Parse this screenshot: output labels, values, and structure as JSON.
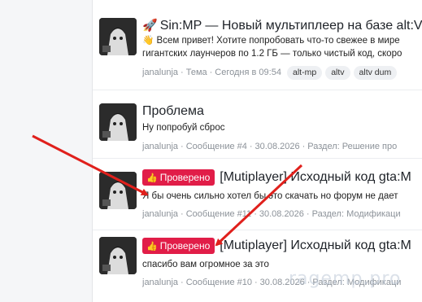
{
  "results": [
    {
      "title_icon": "🚀",
      "title": "Sin:MP — Новый мультиплеер на базе alt:V! д",
      "snippet_icon": "👋",
      "snippet_line1": "Всем привет! Хотите попробовать что-то свежее в мире",
      "snippet_line2": "гигантских лаунчеров по 1.2 ГБ — только чистый код, скоро",
      "author": "janalunja",
      "type": "Тема",
      "date": "Сегодня в 09:54",
      "tags": [
        "alt-mp",
        "altv",
        "altv dum"
      ]
    },
    {
      "title": "Проблема",
      "snippet": "Ну попробуй сброс",
      "author": "janalunja",
      "type": "Сообщение #4",
      "date": "30.08.2026",
      "section": "Раздел: Решение про"
    },
    {
      "badge": "Проверено",
      "title": "[Mutiplayer] Исходный код gta:M",
      "snippet": "Я бы очень сильно хотел бы это скачать но форум не дает",
      "author": "janalunja",
      "type": "Сообщение #11",
      "date": "30.08.2026",
      "section": "Раздел: Модификаци"
    },
    {
      "badge": "Проверено",
      "title": "[Mutiplayer] Исходный код gta:M",
      "snippet": "спасибо вам огромное за это",
      "author": "janalunja",
      "type": "Сообщение #10",
      "date": "30.08.2026",
      "section": "Раздел: Модификаци"
    }
  ],
  "separator": "·",
  "watermark": "ragemp.pro",
  "colors": {
    "badge": "#e11d48",
    "arrow": "#e0201c",
    "meta": "#8c9299"
  },
  "icons": {
    "badge": "thumbs-up-icon",
    "arrow": "red-arrow-annotation"
  }
}
